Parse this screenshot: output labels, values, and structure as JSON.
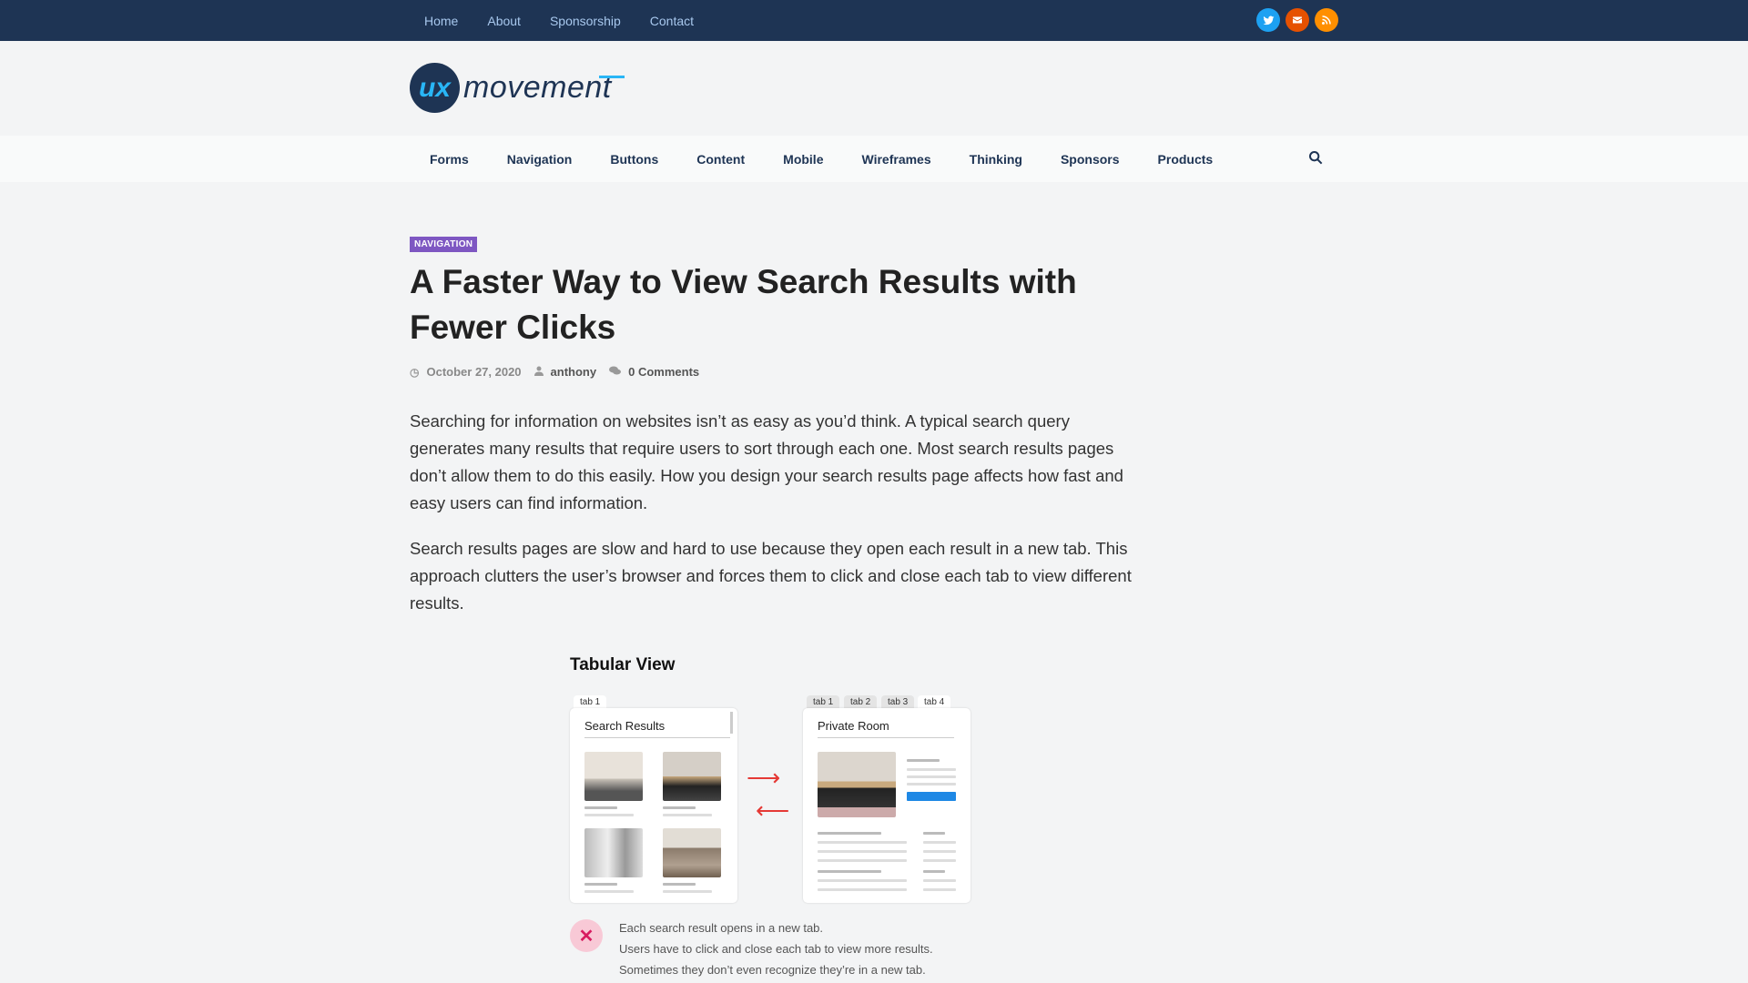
{
  "topbar": {
    "links": [
      "Home",
      "About",
      "Sponsorship",
      "Contact"
    ],
    "social": [
      {
        "name": "twitter-icon",
        "color": "#1da1f2"
      },
      {
        "name": "email-icon",
        "color": "#e65100"
      },
      {
        "name": "rss-icon",
        "color": "#ff8f00"
      }
    ]
  },
  "logo": {
    "mark": "ux",
    "word": "movement"
  },
  "mainnav": {
    "items": [
      "Forms",
      "Navigation",
      "Buttons",
      "Content",
      "Mobile",
      "Wireframes",
      "Thinking",
      "Sponsors",
      "Products"
    ]
  },
  "article": {
    "category": "NAVIGATION",
    "title": "A Faster Way to View Search Results with Fewer Clicks",
    "date": "October 27, 2020",
    "author": "anthony",
    "comments": "0 Comments",
    "paragraphs": [
      "Searching for information on websites isn’t as easy as you’d think. A typical search query generates many results that require users to sort through each one. Most search results pages don’t allow them to do this easily. How you design your search results page affects how fast and easy users can find information.",
      "Search results pages are slow and hard to use because they open each result in a new tab. This approach clutters the user’s browser and forces them to click and close each tab to view different results."
    ]
  },
  "figure": {
    "title": "Tabular View",
    "left_tabs": [
      "tab 1"
    ],
    "left_panel_title": "Search Results",
    "right_tabs": [
      "tab 1",
      "tab 2",
      "tab 3",
      "tab 4"
    ],
    "right_panel_title": "Private Room",
    "captions": [
      "Each search result opens in a new tab.",
      "Users have to click and close each tab to view more results.",
      "Sometimes they don’t even recognize they’re in a new tab."
    ],
    "colors": {
      "accent": "#1e88e5",
      "arrow": "#e53935"
    }
  }
}
